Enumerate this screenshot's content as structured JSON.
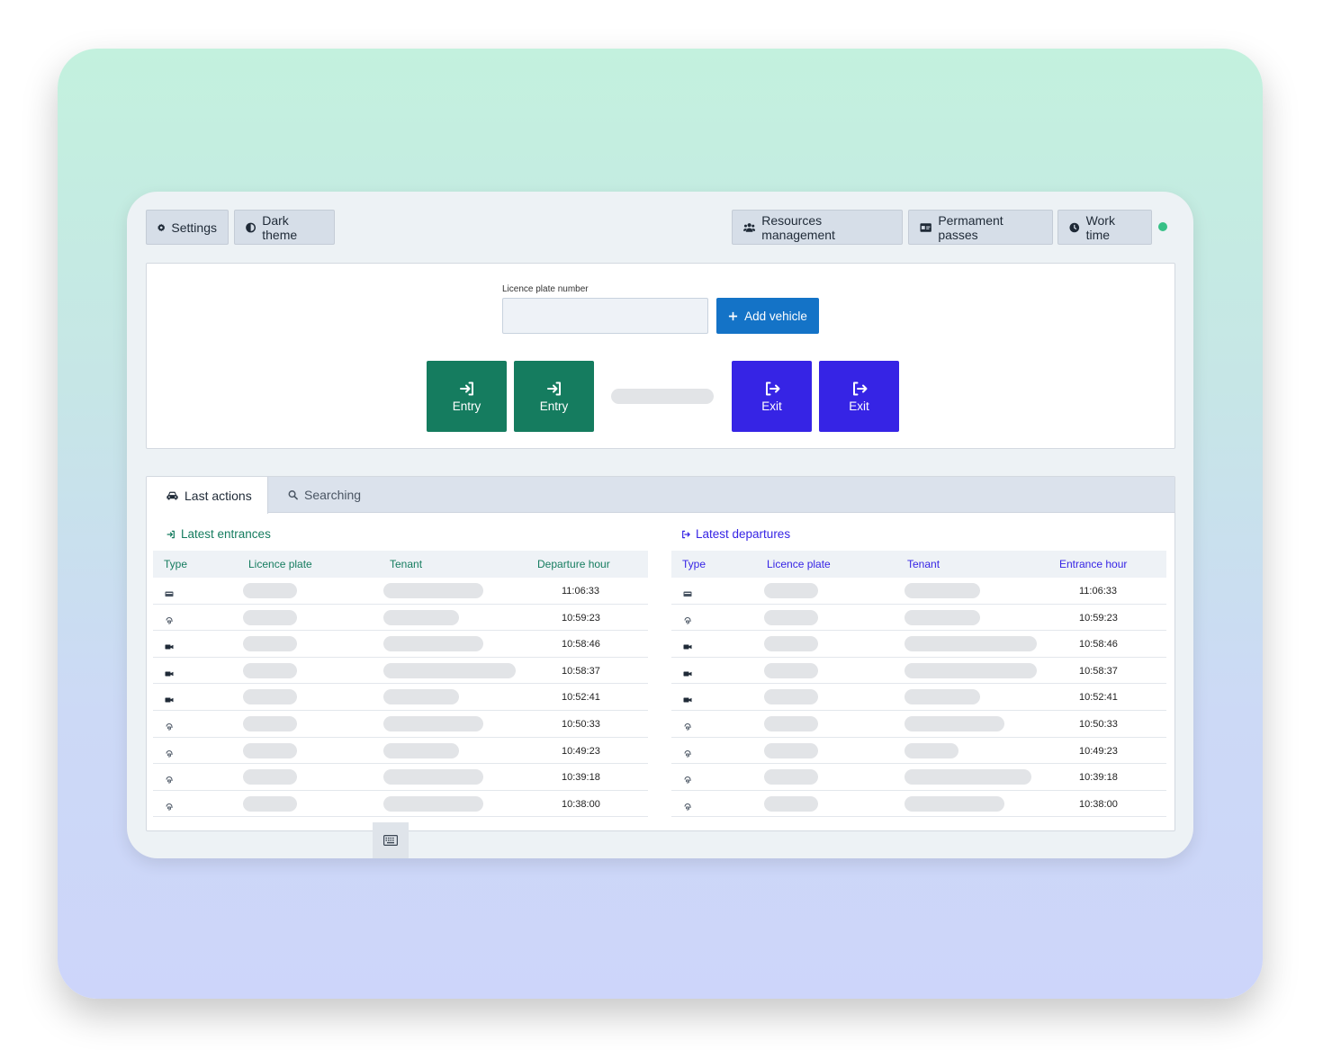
{
  "toolbar": {
    "settings_label": "Settings",
    "dark_theme_label": "Dark theme",
    "resources_label": "Resources management",
    "passes_label": "Permament passes",
    "worktime_label": "Work time"
  },
  "vehicle_form": {
    "plate_label": "Licence plate number",
    "plate_value": "",
    "add_label": "Add vehicle"
  },
  "gates": {
    "entry1_label": "Entry",
    "entry2_label": "Entry",
    "exit1_label": "Exit",
    "exit2_label": "Exit"
  },
  "tabs": {
    "last_actions": "Last actions",
    "searching": "Searching"
  },
  "entrances": {
    "title": "Latest entrances",
    "columns": [
      "Type",
      "Licence plate",
      "Tenant",
      "Departure hour"
    ],
    "rows": [
      {
        "type": "card-icon",
        "time": "11:06:33"
      },
      {
        "type": "fingerprint-icon",
        "time": "10:59:23"
      },
      {
        "type": "camera-icon",
        "time": "10:58:46"
      },
      {
        "type": "camera-icon",
        "time": "10:58:37"
      },
      {
        "type": "camera-icon",
        "time": "10:52:41"
      },
      {
        "type": "fingerprint-icon",
        "time": "10:50:33"
      },
      {
        "type": "fingerprint-icon",
        "time": "10:49:23"
      },
      {
        "type": "fingerprint-icon",
        "time": "10:39:18"
      },
      {
        "type": "fingerprint-icon",
        "time": "10:38:00"
      }
    ]
  },
  "departures": {
    "title": "Latest departures",
    "columns": [
      "Type",
      "Licence plate",
      "Tenant",
      "Entrance hour"
    ],
    "rows": [
      {
        "type": "card-icon",
        "time": "11:06:33"
      },
      {
        "type": "fingerprint-icon",
        "time": "10:59:23"
      },
      {
        "type": "camera-icon",
        "time": "10:58:46"
      },
      {
        "type": "camera-icon",
        "time": "10:58:37"
      },
      {
        "type": "camera-icon",
        "time": "10:52:41"
      },
      {
        "type": "fingerprint-icon",
        "time": "10:50:33"
      },
      {
        "type": "fingerprint-icon",
        "time": "10:49:23"
      },
      {
        "type": "fingerprint-icon",
        "time": "10:39:18"
      },
      {
        "type": "fingerprint-icon",
        "time": "10:38:00"
      }
    ]
  },
  "colors": {
    "entry": "#157c5f",
    "exit": "#3624e5",
    "accent": "#1473c7",
    "status_online": "#36c086"
  }
}
